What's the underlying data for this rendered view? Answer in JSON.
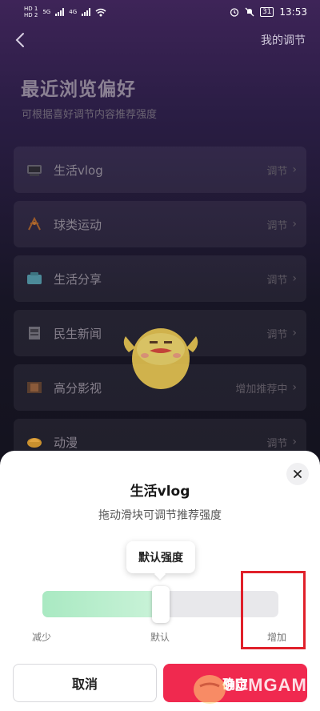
{
  "status_bar": {
    "sim1": "HD 1",
    "sim2": "HD 2",
    "net1": "5G",
    "net2": "4G",
    "battery": "31",
    "time": "13:53"
  },
  "header": {
    "back_icon": "back-arrow-icon",
    "right_link": "我的调节"
  },
  "page": {
    "title": "最近浏览偏好",
    "subtitle": "可根据喜好调节内容推荐强度"
  },
  "categories": [
    {
      "icon": "tv-icon",
      "label": "生活vlog",
      "action": "调节"
    },
    {
      "icon": "sports-icon",
      "label": "球类运动",
      "action": "调节"
    },
    {
      "icon": "share-icon",
      "label": "生活分享",
      "action": "调节"
    },
    {
      "icon": "news-icon",
      "label": "民生新闻",
      "action": "调节"
    },
    {
      "icon": "film-icon",
      "label": "高分影视",
      "action": "增加推荐中"
    },
    {
      "icon": "anime-icon",
      "label": "动漫",
      "action": "调节"
    }
  ],
  "sheet": {
    "title": "生活vlog",
    "description": "拖动滑块可调节推荐强度",
    "tooltip": "默认强度",
    "slider_value": 0.5,
    "scale": {
      "low": "减少",
      "mid": "默认",
      "high": "增加"
    },
    "cancel_label": "取消",
    "confirm_label": "确定"
  },
  "watermark": "9DMGAME",
  "colors": {
    "accent": "#f0294f",
    "slider_fill": "#a9e9c2",
    "highlight": "#e0202a"
  }
}
